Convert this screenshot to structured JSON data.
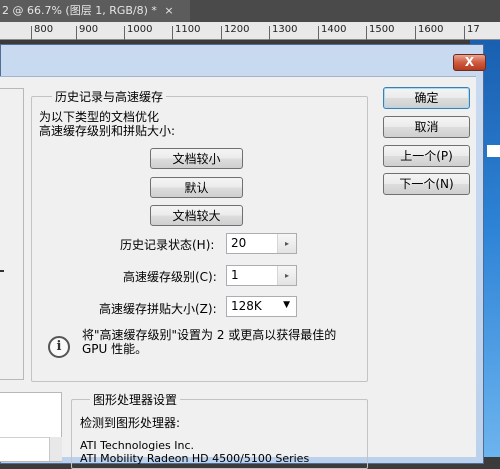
{
  "ps": {
    "tab_title": "2 @ 66.7% (图层 1, RGB/8) *",
    "tab_close": "×",
    "ruler_labels": [
      "800",
      "900",
      "1000",
      "1100",
      "1200",
      "1300",
      "1400",
      "1500",
      "1600",
      "17"
    ]
  },
  "dialog": {
    "close_label": "X"
  },
  "history_cache": {
    "group_title": "历史记录与高速缓存",
    "description_line1": "为以下类型的文档优化",
    "description_line2": "高速缓存级别和拼贴大小:",
    "btn_small_doc": "文档较小",
    "btn_default": "默认",
    "btn_large_doc": "文档较大",
    "history_states_label": "历史记录状态(H):",
    "history_states_value": "20",
    "cache_levels_label": "高速缓存级别(C):",
    "cache_levels_value": "1",
    "cache_tile_label": "高速缓存拼贴大小(Z):",
    "cache_tile_value": "128K",
    "tip_line1": "将\"高速缓存级别\"设置为 2 或更高以获得最佳的",
    "tip_line2": "GPU 性能。",
    "info_icon_glyph": "i"
  },
  "gpu": {
    "group_title": "图形处理器设置",
    "detected_label": "检测到图形处理器:",
    "vendor": "ATI Technologies Inc.",
    "model": "ATI Mobility Radeon HD 4500/5100 Series"
  },
  "actions": {
    "ok": "确定",
    "reset": "取消",
    "prev": "上一个(P)",
    "next": "下一个(N)"
  },
  "icons": {
    "spin_up": "▸",
    "dropdown": "▼"
  }
}
